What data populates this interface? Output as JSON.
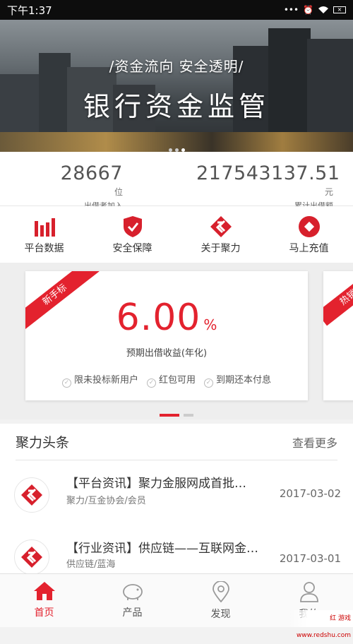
{
  "status_bar": {
    "time": "下午1:37"
  },
  "banner": {
    "subtitle": "/资金流向 安全透明/",
    "title": "银行资金监管"
  },
  "stats": [
    {
      "value": "28667",
      "unit": "位",
      "label": "出借者加入"
    },
    {
      "value": "217543137.51",
      "unit": "元",
      "label": "累计出借额"
    }
  ],
  "quick_actions": [
    {
      "label": "平台数据",
      "icon": "bar-chart-icon"
    },
    {
      "label": "安全保障",
      "icon": "shield-check-icon"
    },
    {
      "label": "关于聚力",
      "icon": "brand-logo-icon"
    },
    {
      "label": "马上充值",
      "icon": "recharge-icon"
    }
  ],
  "product_card": {
    "ribbon": "新手标",
    "rate": "6.00",
    "rate_unit": "%",
    "rate_label": "预期出借收益(年化)",
    "features": [
      "限未投标新用户",
      "红包可用",
      "到期还本付息"
    ]
  },
  "next_card": {
    "ribbon": "热销标"
  },
  "news": {
    "title": "聚力头条",
    "more": "查看更多",
    "items": [
      {
        "title": "【平台资讯】聚力金服网成首批…",
        "tags": "聚力/互金协会/会员",
        "date": "2017-03-02"
      },
      {
        "title": "【行业资讯】供应链——互联网金…",
        "tags": "供应链/蓝海",
        "date": "2017-03-01"
      }
    ]
  },
  "tabbar": [
    {
      "label": "首页",
      "icon": "home-icon",
      "active": true
    },
    {
      "label": "产品",
      "icon": "piggy-bank-icon",
      "active": false
    },
    {
      "label": "发现",
      "icon": "location-pin-icon",
      "active": false
    },
    {
      "label": "我的",
      "icon": "user-icon",
      "active": false
    }
  ],
  "watermark": "红 游戏 www.redshu.com",
  "colors": {
    "accent": "#e3222e",
    "status_bar": "#0d0d0d"
  }
}
